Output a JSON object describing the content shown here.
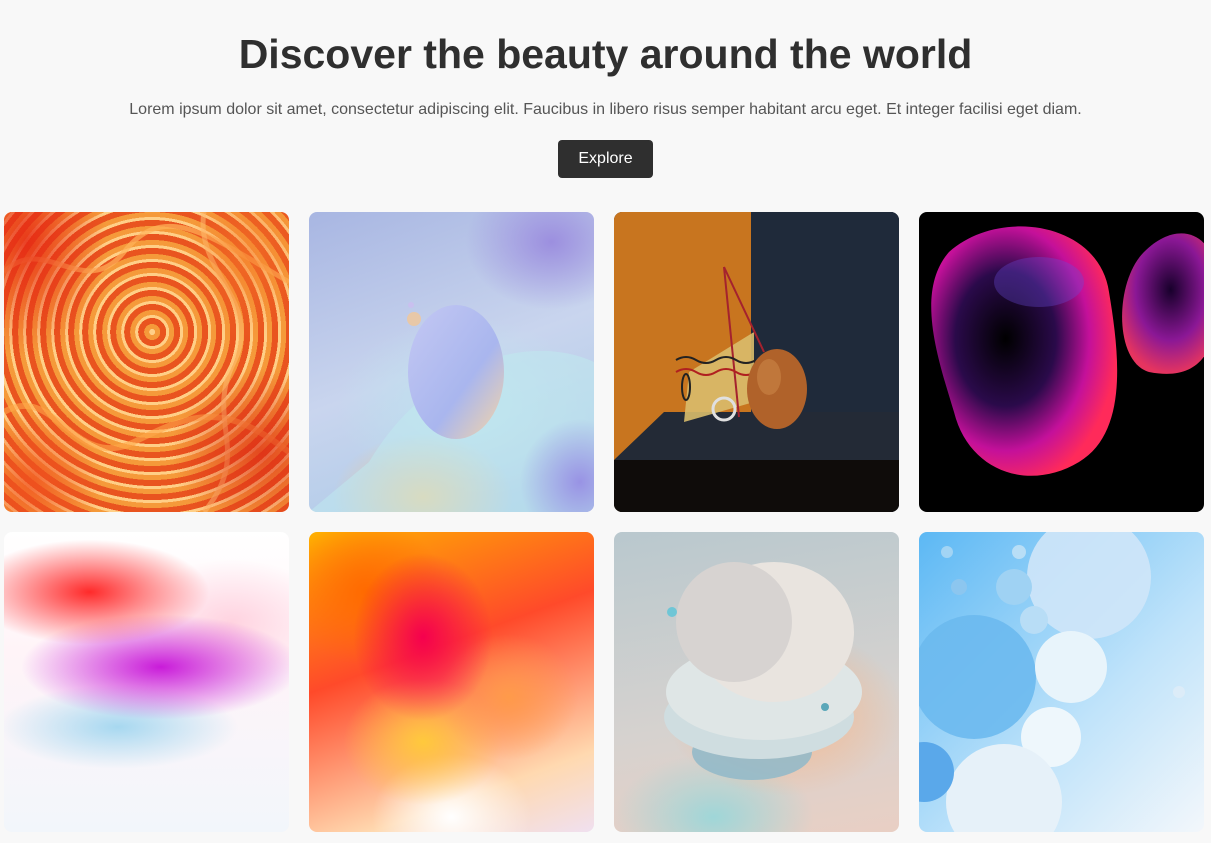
{
  "hero": {
    "title": "Discover the beauty around the world",
    "subtitle": "Lorem ipsum dolor sit amet, consectetur adipiscing elit. Faucibus in libero risus semper habitant arcu eget. Et integer facilisi eget diam.",
    "button_label": "Explore",
    "button_color": "#2f2f2f"
  },
  "gallery": {
    "images": [
      "image-1",
      "image-2",
      "image-3",
      "image-4",
      "image-5",
      "image-6",
      "image-7",
      "image-8"
    ]
  }
}
